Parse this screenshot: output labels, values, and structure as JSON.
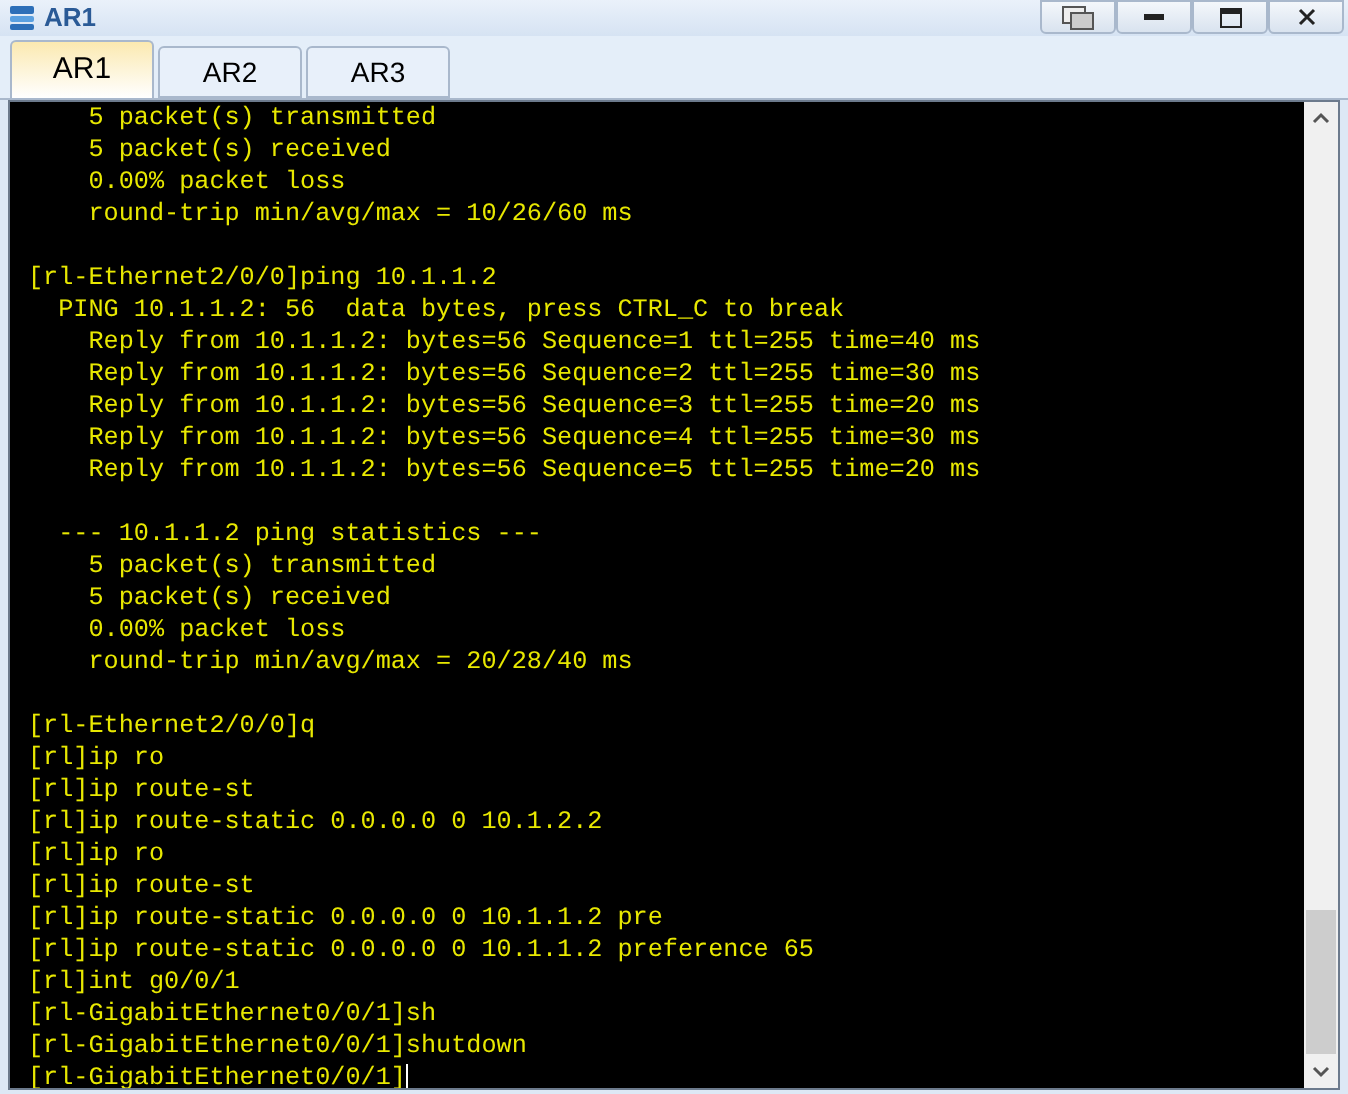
{
  "window": {
    "title": "AR1"
  },
  "tabs": [
    {
      "label": "AR1",
      "selected": true
    },
    {
      "label": "AR2",
      "selected": false
    },
    {
      "label": "AR3",
      "selected": false
    }
  ],
  "terminal": {
    "cursor": true,
    "lines": [
      {
        "kind": "text",
        "text": "    5 packet(s) transmitted"
      },
      {
        "kind": "text",
        "text": "    5 packet(s) received"
      },
      {
        "kind": "text",
        "text": "    0.00% packet loss"
      },
      {
        "kind": "text",
        "text": "    round-trip min/avg/max = 10/26/60 ms"
      },
      {
        "kind": "blank"
      },
      {
        "kind": "text",
        "text": "[rl-Ethernet2/0/0]ping 10.1.1.2"
      },
      {
        "kind": "text",
        "text": "  PING 10.1.1.2: 56  data bytes, press CTRL_C to break"
      },
      {
        "kind": "text",
        "text": "    Reply from 10.1.1.2: bytes=56 Sequence=1 ttl=255 time=40 ms"
      },
      {
        "kind": "text",
        "text": "    Reply from 10.1.1.2: bytes=56 Sequence=2 ttl=255 time=30 ms"
      },
      {
        "kind": "text",
        "text": "    Reply from 10.1.1.2: bytes=56 Sequence=3 ttl=255 time=20 ms"
      },
      {
        "kind": "text",
        "text": "    Reply from 10.1.1.2: bytes=56 Sequence=4 ttl=255 time=30 ms"
      },
      {
        "kind": "text",
        "text": "    Reply from 10.1.1.2: bytes=56 Sequence=5 ttl=255 time=20 ms"
      },
      {
        "kind": "blank"
      },
      {
        "kind": "text",
        "text": "  --- 10.1.1.2 ping statistics ---"
      },
      {
        "kind": "text",
        "text": "    5 packet(s) transmitted"
      },
      {
        "kind": "text",
        "text": "    5 packet(s) received"
      },
      {
        "kind": "text",
        "text": "    0.00% packet loss"
      },
      {
        "kind": "text",
        "text": "    round-trip min/avg/max = 20/28/40 ms"
      },
      {
        "kind": "blank"
      },
      {
        "kind": "text",
        "text": "[rl-Ethernet2/0/0]q"
      },
      {
        "kind": "text",
        "text": "[rl]ip ro"
      },
      {
        "kind": "text",
        "text": "[rl]ip route-st"
      },
      {
        "kind": "text",
        "text": "[rl]ip route-static 0.0.0.0 0 10.1.2.2"
      },
      {
        "kind": "text",
        "text": "[rl]ip ro"
      },
      {
        "kind": "text",
        "text": "[rl]ip route-st"
      },
      {
        "kind": "text",
        "text": "[rl]ip route-static 0.0.0.0 0 10.1.1.2 pre"
      },
      {
        "kind": "text",
        "text": "[rl]ip route-static 0.0.0.0 0 10.1.1.2 preference 65"
      },
      {
        "kind": "text",
        "text": "[rl]int g0/0/1"
      },
      {
        "kind": "text",
        "text": "[rl-GigabitEthernet0/0/1]sh"
      },
      {
        "kind": "text",
        "text": "[rl-GigabitEthernet0/0/1]shutdown"
      },
      {
        "kind": "text",
        "text": "[rl-GigabitEthernet0/0/1]"
      }
    ]
  }
}
